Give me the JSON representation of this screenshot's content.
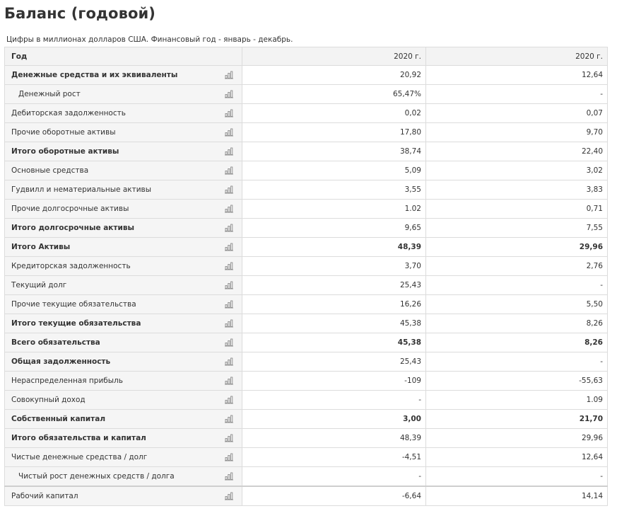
{
  "page": {
    "title": "Баланс (годовой)",
    "subtitle": "Цифры в миллионах долларов США. Финансовый год - январь - декабрь."
  },
  "table": {
    "header": {
      "label": "Год",
      "col1": "2020 г.",
      "col2": "2020 г."
    },
    "rows": [
      {
        "label": "Денежные средства и их эквиваленты",
        "v1": "20,92",
        "v2": "12,64",
        "style": "semibold",
        "indent": false,
        "icon": "bar-chart-icon"
      },
      {
        "label": "Денежный рост",
        "v1": "65,47%",
        "v2": "-",
        "style": "normal",
        "indent": true,
        "icon": "bar-chart-icon"
      },
      {
        "label": "Дебиторская задолженность",
        "v1": "0,02",
        "v2": "0,07",
        "style": "normal",
        "indent": false,
        "icon": "bar-chart-icon"
      },
      {
        "label": "Прочие оборотные активы",
        "v1": "17,80",
        "v2": "9,70",
        "style": "normal",
        "indent": false,
        "icon": "bar-chart-icon"
      },
      {
        "label": "Итого оборотные активы",
        "v1": "38,74",
        "v2": "22,40",
        "style": "semibold",
        "indent": false,
        "icon": "bar-chart-icon"
      },
      {
        "label": "Основные средства",
        "v1": "5,09",
        "v2": "3,02",
        "style": "normal",
        "indent": false,
        "icon": "bar-chart-icon"
      },
      {
        "label": "Гудвилл и нематериальные активы",
        "v1": "3,55",
        "v2": "3,83",
        "style": "normal",
        "indent": false,
        "icon": "bar-chart-icon"
      },
      {
        "label": "Прочие долгосрочные активы",
        "v1": "1.02",
        "v2": "0,71",
        "style": "normal",
        "indent": false,
        "icon": "bar-chart-icon"
      },
      {
        "label": "Итого долгосрочные активы",
        "v1": "9,65",
        "v2": "7,55",
        "style": "semibold",
        "indent": false,
        "icon": "bar-chart-icon"
      },
      {
        "label": "Итого Активы",
        "v1": "48,39",
        "v2": "29,96",
        "style": "bold",
        "indent": false,
        "icon": "bar-chart-icon"
      },
      {
        "label": "Кредиторская задолженность",
        "v1": "3,70",
        "v2": "2,76",
        "style": "normal",
        "indent": false,
        "icon": "bar-chart-icon"
      },
      {
        "label": "Текущий долг",
        "v1": "25,43",
        "v2": "-",
        "style": "normal",
        "indent": false,
        "icon": "bar-chart-icon"
      },
      {
        "label": "Прочие текущие обязательства",
        "v1": "16,26",
        "v2": "5,50",
        "style": "normal",
        "indent": false,
        "icon": "bar-chart-icon"
      },
      {
        "label": "Итого текущие обязательства",
        "v1": "45,38",
        "v2": "8,26",
        "style": "semibold",
        "indent": false,
        "icon": "bar-chart-icon"
      },
      {
        "label": "Всего обязательства",
        "v1": "45,38",
        "v2": "8,26",
        "style": "bold",
        "indent": false,
        "icon": "bar-chart-icon"
      },
      {
        "label": "Общая задолженность",
        "v1": "25,43",
        "v2": "-",
        "style": "semibold",
        "indent": false,
        "icon": "bar-chart-icon"
      },
      {
        "label": "Нераспределенная прибыль",
        "v1": "-109",
        "v2": "-55,63",
        "style": "normal",
        "indent": false,
        "icon": "bar-chart-icon"
      },
      {
        "label": "Совокупный доход",
        "v1": "-",
        "v2": "1.09",
        "style": "normal",
        "indent": false,
        "icon": "bar-chart-icon"
      },
      {
        "label": "Собственный капитал",
        "v1": "3,00",
        "v2": "21,70",
        "style": "bold",
        "indent": false,
        "icon": "bar-chart-icon"
      },
      {
        "label": "Итого обязательства и капитал",
        "v1": "48,39",
        "v2": "29,96",
        "style": "semibold",
        "indent": false,
        "icon": "bar-chart-icon"
      },
      {
        "label": "Чистые денежные средства / долг",
        "v1": "-4,51",
        "v2": "12,64",
        "style": "normal",
        "indent": false,
        "icon": "bar-chart-icon"
      },
      {
        "label": "Чистый рост денежных средств / долга",
        "v1": "-",
        "v2": "-",
        "style": "normal",
        "indent": true,
        "icon": "bar-chart-icon"
      },
      {
        "label": "Рабочий капитал",
        "v1": "-6,64",
        "v2": "14,14",
        "style": "normal",
        "indent": false,
        "icon": "bar-chart-icon",
        "separator": true
      }
    ]
  },
  "colors": {
    "label_bg": "#f5f5f5",
    "header_bg": "#f3f3f3",
    "border": "#dcdcdc",
    "text": "#333333",
    "icon": "#8a8a8a"
  }
}
